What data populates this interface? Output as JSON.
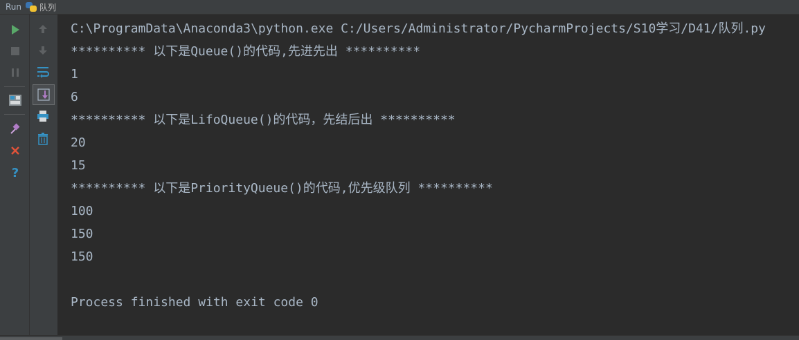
{
  "titlebar": {
    "run_label": "Run",
    "tab_name": "队列"
  },
  "toolbar": {
    "left": [
      "run-icon",
      "stop-icon",
      "pause-icon",
      "layout-icon",
      "pin-icon",
      "close-icon",
      "help-icon"
    ],
    "right": [
      "up-arrow-icon",
      "down-arrow-icon",
      "soft-wrap-icon",
      "scroll-to-end-icon",
      "print-icon",
      "trash-icon"
    ]
  },
  "console": {
    "lines": [
      "C:\\ProgramData\\Anaconda3\\python.exe C:/Users/Administrator/PycharmProjects/S10学习/D41/队列.py",
      "********** 以下是Queue()的代码,先进先出 **********",
      "1",
      "6",
      "********** 以下是LifoQueue()的代码，先结后出 **********",
      "20",
      "15",
      "********** 以下是PriorityQueue()的代码,优先级队列 **********",
      "100",
      "150",
      "150",
      "",
      "Process finished with exit code 0"
    ]
  },
  "colors": {
    "background": "#2b2b2b",
    "panel": "#3c3f41",
    "text": "#a9b7c6",
    "run_green": "#59a869",
    "close_red": "#e0533a",
    "help_blue": "#3592c4"
  }
}
